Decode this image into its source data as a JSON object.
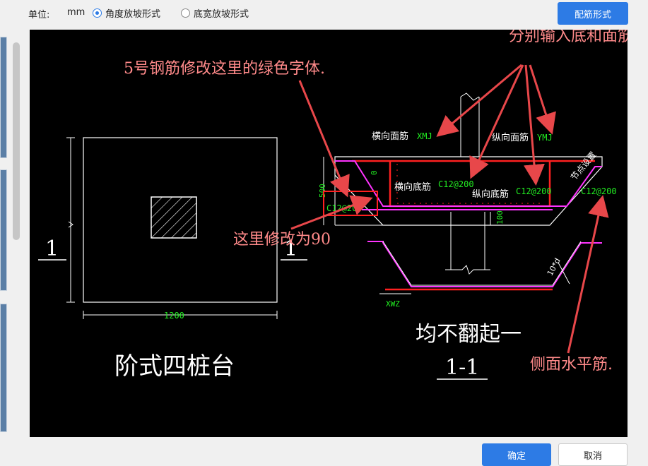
{
  "toolbar": {
    "unit_label": "单位:",
    "unit_value": "mm",
    "radio_angle": "角度放坡形式",
    "radio_width": "底宽放坡形式",
    "config_button": "配筋形式"
  },
  "footer": {
    "ok_button": "确定",
    "cancel_button": "取消"
  },
  "drawing": {
    "plan": {
      "title": "阶式四桩台",
      "section_mark_left": "1",
      "section_mark_right": "1",
      "width_dim": "1200"
    },
    "section": {
      "title": "1-1",
      "top_bar_label": "横向面筋",
      "top_bar_code": "XMJ",
      "top_bar_label2": "纵向面筋",
      "top_bar_code2": "YMJ",
      "bottom_bar_label": "横向底筋",
      "bottom_bar_value": "C12@200",
      "bottom_bar_label2": "纵向底筋",
      "bottom_bar_value2": "C12@200",
      "left_bar_value": "C12@200",
      "right_bar_value": "C12@200",
      "dim_500": "500",
      "dim_0": "0",
      "dim_100": "100",
      "dim_10d": "10*d",
      "xwz": "XWZ",
      "node_note": "节点设置"
    },
    "annotations": {
      "rebar5": "5号钢筋修改这里的绿色字体.",
      "top_bottom": "分别输入底和面筋.",
      "modify90": "这里修改为90",
      "no_bend": "均不翻起一",
      "side_bar": "侧面水平筋."
    }
  },
  "colors": {
    "accent": "#2d7be5",
    "rebar_red": "#ff2020",
    "rebar_magenta": "#ff33ff",
    "label_green": "#22ee22",
    "annotation_pink": "#ff8a8a",
    "arrow_red": "#e8474a"
  }
}
